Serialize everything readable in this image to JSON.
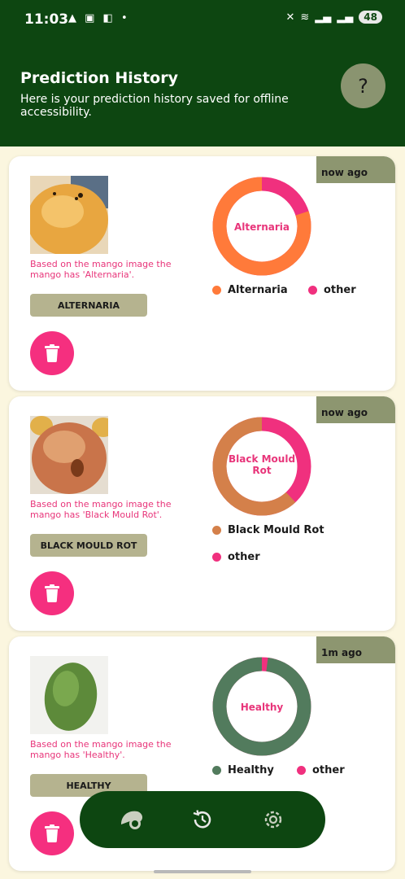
{
  "status_bar": {
    "time": "11:03",
    "battery": "48"
  },
  "header": {
    "title": "Prediction History",
    "subtitle": "Here is your prediction history saved for offline accessibility.",
    "help_label": "?"
  },
  "colors": {
    "header_bg": "#0d4611",
    "page_bg": "#fbf6df",
    "badge_bg": "#8d9670",
    "label_bg": "#b5b38f",
    "delete_bg": "#f52f7f",
    "other_color": "#f0307e"
  },
  "predictions": [
    {
      "time_ago": "now ago",
      "image_icon": "mango-photo-yellow",
      "description": "Based on the mango image the mango has 'Alternaria'.",
      "label": "ALTERNARIA",
      "chart_center": "Alternaria",
      "chart_color": "#ff7a3a",
      "legend": [
        "Alternaria",
        "other"
      ],
      "confidence_fraction": 0.8
    },
    {
      "time_ago": "now ago",
      "image_icon": "mango-photo-red",
      "description": "Based on the mango image the mango has 'Black Mould Rot'.",
      "label": "BLACK MOULD ROT",
      "chart_center": "Black Mould Rot",
      "chart_color": "#d4804a",
      "legend": [
        "Black Mould Rot",
        "other"
      ],
      "confidence_fraction": 0.62
    },
    {
      "time_ago": "1m ago",
      "image_icon": "mango-photo-green",
      "description": "Based on the mango image the mango has 'Healthy'.",
      "label": "HEALTHY",
      "chart_center": "Healthy",
      "chart_color": "#527b5d",
      "legend": [
        "Healthy",
        "other"
      ],
      "confidence_fraction": 0.98
    }
  ],
  "nav": {
    "items": [
      "predict-icon",
      "history-icon",
      "settings-icon"
    ]
  }
}
